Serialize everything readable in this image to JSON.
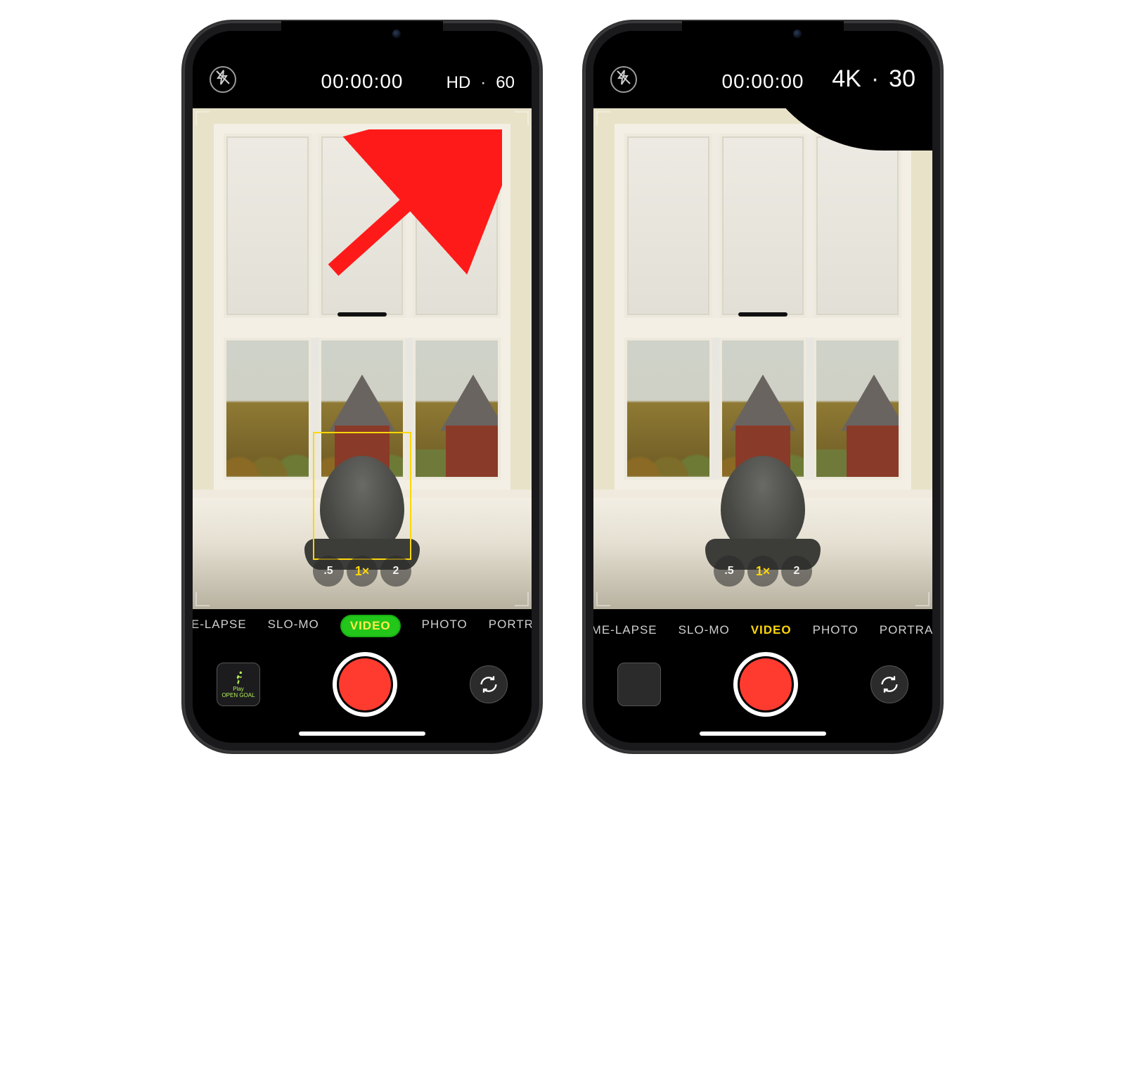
{
  "phones": [
    {
      "timer": "00:00:00",
      "format": {
        "resolution": "HD",
        "separator": "·",
        "fps": "60",
        "style": "small"
      },
      "zoom": {
        "options": [
          ".5",
          "1×",
          "2"
        ],
        "selected": "1×"
      },
      "modes": [
        "IME-LAPSE",
        "SLO-MO",
        "VIDEO",
        "PHOTO",
        "PORTRAI"
      ],
      "selected_mode": "VIDEO",
      "highlight_green": true,
      "focus_box": true,
      "thumb": {
        "type": "workout",
        "line1": "Play",
        "line2": "OPEN GOAL"
      },
      "annotation_arrow": true,
      "mask_top_right": false
    },
    {
      "timer": "00:00:00",
      "format": {
        "resolution": "4K",
        "separator": "·",
        "fps": "30",
        "style": "big"
      },
      "zoom": {
        "options": [
          ".5",
          "1×",
          "2"
        ],
        "selected": "1×"
      },
      "modes": [
        "IME-LAPSE",
        "SLO-MO",
        "VIDEO",
        "PHOTO",
        "PORTRAI"
      ],
      "selected_mode": "VIDEO",
      "highlight_green": false,
      "focus_box": false,
      "thumb": {
        "type": "photo"
      },
      "annotation_arrow": false,
      "mask_top_right": true
    }
  ]
}
